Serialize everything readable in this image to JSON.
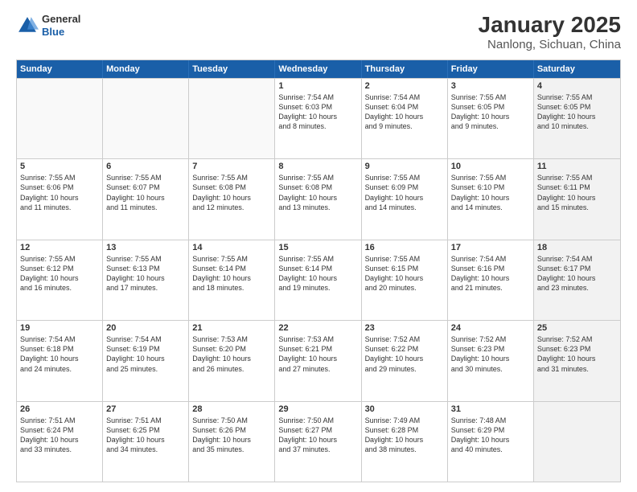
{
  "logo": {
    "general": "General",
    "blue": "Blue"
  },
  "title": "January 2025",
  "subtitle": "Nanlong, Sichuan, China",
  "days": [
    "Sunday",
    "Monday",
    "Tuesday",
    "Wednesday",
    "Thursday",
    "Friday",
    "Saturday"
  ],
  "weeks": [
    [
      {
        "num": "",
        "detail": "",
        "empty": true
      },
      {
        "num": "",
        "detail": "",
        "empty": true
      },
      {
        "num": "",
        "detail": "",
        "empty": true
      },
      {
        "num": "1",
        "detail": "Sunrise: 7:54 AM\nSunset: 6:03 PM\nDaylight: 10 hours\nand 8 minutes.",
        "empty": false
      },
      {
        "num": "2",
        "detail": "Sunrise: 7:54 AM\nSunset: 6:04 PM\nDaylight: 10 hours\nand 9 minutes.",
        "empty": false
      },
      {
        "num": "3",
        "detail": "Sunrise: 7:55 AM\nSunset: 6:05 PM\nDaylight: 10 hours\nand 9 minutes.",
        "empty": false
      },
      {
        "num": "4",
        "detail": "Sunrise: 7:55 AM\nSunset: 6:05 PM\nDaylight: 10 hours\nand 10 minutes.",
        "empty": false,
        "shaded": true
      }
    ],
    [
      {
        "num": "5",
        "detail": "Sunrise: 7:55 AM\nSunset: 6:06 PM\nDaylight: 10 hours\nand 11 minutes.",
        "empty": false
      },
      {
        "num": "6",
        "detail": "Sunrise: 7:55 AM\nSunset: 6:07 PM\nDaylight: 10 hours\nand 11 minutes.",
        "empty": false
      },
      {
        "num": "7",
        "detail": "Sunrise: 7:55 AM\nSunset: 6:08 PM\nDaylight: 10 hours\nand 12 minutes.",
        "empty": false
      },
      {
        "num": "8",
        "detail": "Sunrise: 7:55 AM\nSunset: 6:08 PM\nDaylight: 10 hours\nand 13 minutes.",
        "empty": false
      },
      {
        "num": "9",
        "detail": "Sunrise: 7:55 AM\nSunset: 6:09 PM\nDaylight: 10 hours\nand 14 minutes.",
        "empty": false
      },
      {
        "num": "10",
        "detail": "Sunrise: 7:55 AM\nSunset: 6:10 PM\nDaylight: 10 hours\nand 14 minutes.",
        "empty": false
      },
      {
        "num": "11",
        "detail": "Sunrise: 7:55 AM\nSunset: 6:11 PM\nDaylight: 10 hours\nand 15 minutes.",
        "empty": false,
        "shaded": true
      }
    ],
    [
      {
        "num": "12",
        "detail": "Sunrise: 7:55 AM\nSunset: 6:12 PM\nDaylight: 10 hours\nand 16 minutes.",
        "empty": false
      },
      {
        "num": "13",
        "detail": "Sunrise: 7:55 AM\nSunset: 6:13 PM\nDaylight: 10 hours\nand 17 minutes.",
        "empty": false
      },
      {
        "num": "14",
        "detail": "Sunrise: 7:55 AM\nSunset: 6:14 PM\nDaylight: 10 hours\nand 18 minutes.",
        "empty": false
      },
      {
        "num": "15",
        "detail": "Sunrise: 7:55 AM\nSunset: 6:14 PM\nDaylight: 10 hours\nand 19 minutes.",
        "empty": false
      },
      {
        "num": "16",
        "detail": "Sunrise: 7:55 AM\nSunset: 6:15 PM\nDaylight: 10 hours\nand 20 minutes.",
        "empty": false
      },
      {
        "num": "17",
        "detail": "Sunrise: 7:54 AM\nSunset: 6:16 PM\nDaylight: 10 hours\nand 21 minutes.",
        "empty": false
      },
      {
        "num": "18",
        "detail": "Sunrise: 7:54 AM\nSunset: 6:17 PM\nDaylight: 10 hours\nand 23 minutes.",
        "empty": false,
        "shaded": true
      }
    ],
    [
      {
        "num": "19",
        "detail": "Sunrise: 7:54 AM\nSunset: 6:18 PM\nDaylight: 10 hours\nand 24 minutes.",
        "empty": false
      },
      {
        "num": "20",
        "detail": "Sunrise: 7:54 AM\nSunset: 6:19 PM\nDaylight: 10 hours\nand 25 minutes.",
        "empty": false
      },
      {
        "num": "21",
        "detail": "Sunrise: 7:53 AM\nSunset: 6:20 PM\nDaylight: 10 hours\nand 26 minutes.",
        "empty": false
      },
      {
        "num": "22",
        "detail": "Sunrise: 7:53 AM\nSunset: 6:21 PM\nDaylight: 10 hours\nand 27 minutes.",
        "empty": false
      },
      {
        "num": "23",
        "detail": "Sunrise: 7:52 AM\nSunset: 6:22 PM\nDaylight: 10 hours\nand 29 minutes.",
        "empty": false
      },
      {
        "num": "24",
        "detail": "Sunrise: 7:52 AM\nSunset: 6:23 PM\nDaylight: 10 hours\nand 30 minutes.",
        "empty": false
      },
      {
        "num": "25",
        "detail": "Sunrise: 7:52 AM\nSunset: 6:23 PM\nDaylight: 10 hours\nand 31 minutes.",
        "empty": false,
        "shaded": true
      }
    ],
    [
      {
        "num": "26",
        "detail": "Sunrise: 7:51 AM\nSunset: 6:24 PM\nDaylight: 10 hours\nand 33 minutes.",
        "empty": false
      },
      {
        "num": "27",
        "detail": "Sunrise: 7:51 AM\nSunset: 6:25 PM\nDaylight: 10 hours\nand 34 minutes.",
        "empty": false
      },
      {
        "num": "28",
        "detail": "Sunrise: 7:50 AM\nSunset: 6:26 PM\nDaylight: 10 hours\nand 35 minutes.",
        "empty": false
      },
      {
        "num": "29",
        "detail": "Sunrise: 7:50 AM\nSunset: 6:27 PM\nDaylight: 10 hours\nand 37 minutes.",
        "empty": false
      },
      {
        "num": "30",
        "detail": "Sunrise: 7:49 AM\nSunset: 6:28 PM\nDaylight: 10 hours\nand 38 minutes.",
        "empty": false
      },
      {
        "num": "31",
        "detail": "Sunrise: 7:48 AM\nSunset: 6:29 PM\nDaylight: 10 hours\nand 40 minutes.",
        "empty": false
      },
      {
        "num": "",
        "detail": "",
        "empty": true,
        "shaded": true
      }
    ]
  ]
}
